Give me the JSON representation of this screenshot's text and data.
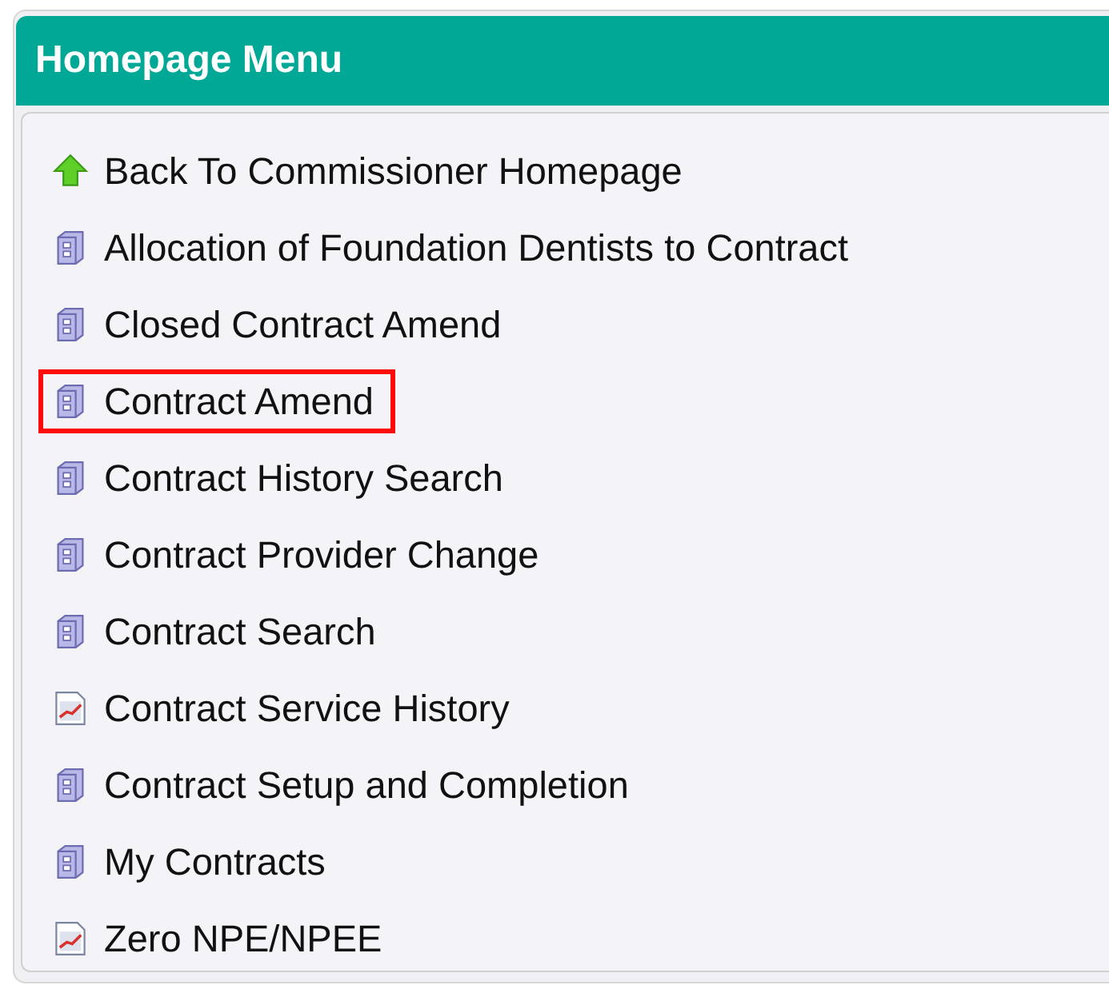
{
  "panel": {
    "title": "Homepage Menu"
  },
  "items": [
    {
      "label": "Back To Commissioner Homepage",
      "kind": "up",
      "highlighted": false
    },
    {
      "label": "Allocation of Foundation Dentists to Contract",
      "kind": "cabinet",
      "highlighted": false
    },
    {
      "label": "Closed Contract Amend",
      "kind": "cabinet",
      "highlighted": false
    },
    {
      "label": "Contract Amend",
      "kind": "cabinet",
      "highlighted": true
    },
    {
      "label": "Contract History Search",
      "kind": "cabinet",
      "highlighted": false
    },
    {
      "label": "Contract Provider Change",
      "kind": "cabinet",
      "highlighted": false
    },
    {
      "label": "Contract Search",
      "kind": "cabinet",
      "highlighted": false
    },
    {
      "label": "Contract Service History",
      "kind": "report",
      "highlighted": false
    },
    {
      "label": "Contract Setup and Completion",
      "kind": "cabinet",
      "highlighted": false
    },
    {
      "label": "My Contracts",
      "kind": "cabinet",
      "highlighted": false
    },
    {
      "label": "Zero NPE/NPEE",
      "kind": "report",
      "highlighted": false
    }
  ]
}
